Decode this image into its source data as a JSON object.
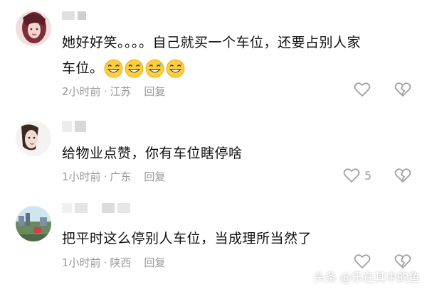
{
  "comments": [
    {
      "text_line1": "她好好笑。。。。自己就买一个车位，还要占别人家",
      "text_line2": "车位。",
      "emojis": [
        "grinning-sweat-emoji",
        "grinning-sweat-emoji",
        "grinning-sweat-emoji",
        "grinning-sweat-emoji"
      ],
      "time": "2小时前",
      "location": "江苏",
      "reply_label": "回复",
      "like_count": ""
    },
    {
      "text_line1": "给物业点赞，你有车位瞎停啥",
      "time": "1小时前",
      "location": "广东",
      "reply_label": "回复",
      "like_count": "5"
    },
    {
      "text_line1": "把平时这么停别人车位，当成理所当然了",
      "time": "1小时前",
      "location": "陕西",
      "reply_label": "回复",
      "like_count": ""
    }
  ],
  "meta_separator": "·",
  "watermark": "头条 @乐在其中的鱼",
  "colors": {
    "text": "#111111",
    "meta": "#999999",
    "icon": "#a0a0a0"
  }
}
